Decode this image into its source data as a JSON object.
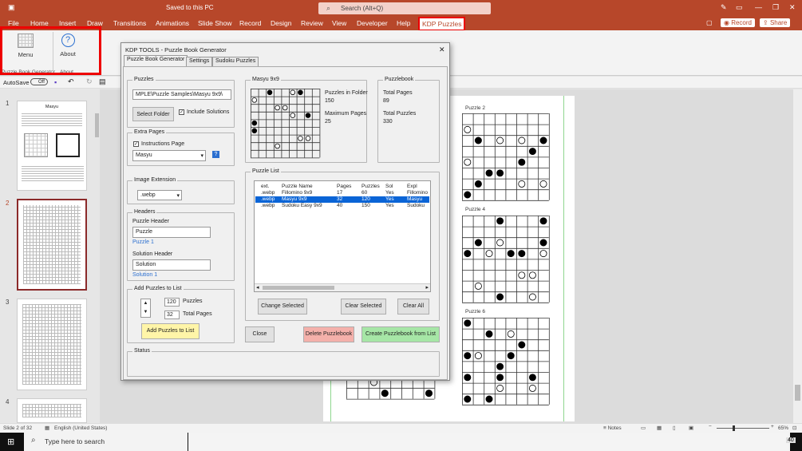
{
  "titlebar": {
    "doc_status": "Saved to this PC",
    "search_placeholder": "Search (Alt+Q)"
  },
  "ribbon_tabs": [
    "File",
    "Home",
    "Insert",
    "Draw",
    "Transitions",
    "Animations",
    "Slide Show",
    "Record",
    "Design",
    "Review",
    "View",
    "Developer",
    "Help",
    "KDP Puzzles"
  ],
  "record_label": "Record",
  "share_label": "Share",
  "ribbon": {
    "menu_label": "Menu",
    "about_label": "About",
    "group1": "Puzzle Book Generator",
    "group2": "About"
  },
  "qat": {
    "autosave": "AutoSave",
    "autosave_state": "Off"
  },
  "thumb_numbers": [
    "1",
    "2",
    "3",
    "4"
  ],
  "thumb1_title": "Masyu",
  "slide_labels": [
    "Puzzle 2",
    "Puzzle 4",
    "Puzzle 6"
  ],
  "dialog": {
    "title": "KDP TOOLS - Puzzle Book Generator",
    "close_x": "✕",
    "tabs": [
      "Puzzle Book Generator",
      "Settings",
      "Sudoku Puzzles"
    ],
    "puzzles_frame": "Puzzles",
    "path": "MPLE\\Puzzle Samples\\Masyu 9x9\\",
    "select_folder": "Select Folder",
    "include_solutions": "Include Solutions",
    "extra_pages": "Extra Pages",
    "instructions_page": "Instructions Page",
    "puzzle_type": "Masyu",
    "help_q": "?",
    "image_extension": "Image Extension",
    "ext_value": ".webp",
    "headers": "Headers",
    "puzzle_header_label": "Puzzle Header",
    "puzzle_header_value": "Puzzle",
    "puzzle_header_preview": "Puzzle 1",
    "solution_header_label": "Solution Header",
    "solution_header_value": "Solution",
    "solution_header_preview": "Solution 1",
    "add_frame": "Add Puzzles to List",
    "puzzles_count": "120",
    "puzzles_word": "Puzzles",
    "total_pages_count": "32",
    "total_pages_word": "Total Pages",
    "add_button": "Add Puzzles to List",
    "preview_frame": "Masyu 9x9",
    "in_folder_label": "Puzzles in Folder",
    "in_folder_value": "150",
    "max_pages_label": "Maximum Pages",
    "max_pages_value": "25",
    "puzzlebook_frame": "Puzzlebook",
    "total_pages_label": "Total Pages",
    "total_pages_value": "89",
    "total_puzzles_label": "Total Puzzles",
    "total_puzzles_value": "330",
    "list_frame": "Puzzle List",
    "list_headers": [
      "ext.",
      "Puzzle Name",
      "Pages",
      "Puzzles",
      "Sol",
      "Expl"
    ],
    "list_rows": [
      [
        ".webp",
        "Fillomino 9x9",
        "17",
        "60",
        "Yes",
        "Fillomino"
      ],
      [
        ".webp",
        "Masyu 9x9",
        "32",
        "120",
        "Yes",
        "Masyu"
      ],
      [
        ".webp",
        "Sudoku Easy 9x9",
        "40",
        "150",
        "Yes",
        "Sudoku"
      ]
    ],
    "change_selected": "Change Selected",
    "clear_selected": "Clear Selected",
    "clear_all": "Clear All",
    "close_button": "Close",
    "delete_button": "Delete Puzzlebook",
    "create_button": "Create Puzzlebook from List",
    "status_frame": "Status"
  },
  "statusbar": {
    "slide": "Slide 2 of 32",
    "language": "English (United States)",
    "notes": "Notes",
    "zoom": "65%"
  },
  "taskbar": {
    "search": "Type here to search",
    "badge": "40"
  },
  "colors": {
    "accent": "#b7472a",
    "highlight": "#e00000",
    "selection": "#0a64d6",
    "add_button": "#fff5a8",
    "delete_button": "#f4b0aa",
    "create_button": "#a6e6a6"
  }
}
